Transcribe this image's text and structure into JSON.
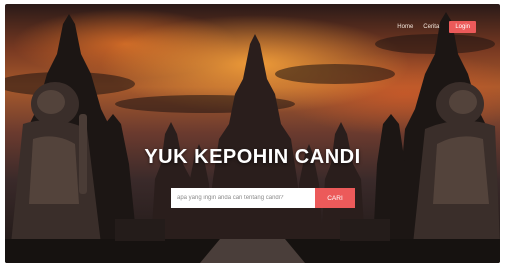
{
  "nav": {
    "links": [
      "Home",
      "Cerita"
    ],
    "login_label": "Login"
  },
  "hero": {
    "title": "YUK KEPOHIN CANDI"
  },
  "search": {
    "placeholder": "apa yang ingin anda cari tentang candi?",
    "button_label": "CARI"
  },
  "colors": {
    "accent": "#ec5a5a",
    "hero_text": "#ffffff"
  },
  "background": {
    "scene": "temple-sunset-photo"
  }
}
